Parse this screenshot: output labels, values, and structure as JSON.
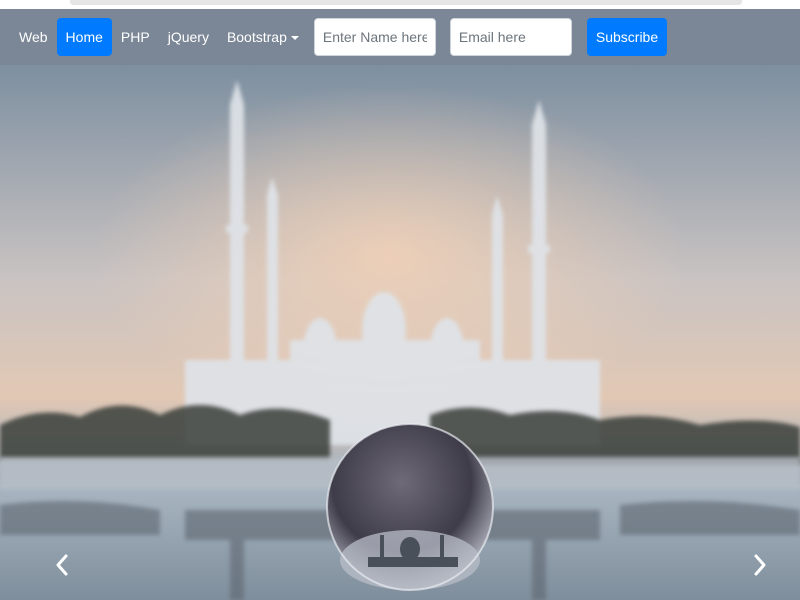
{
  "navbar": {
    "links": [
      {
        "label": "Web",
        "active": false
      },
      {
        "label": "Home",
        "active": true
      },
      {
        "label": "PHP",
        "active": false
      },
      {
        "label": "jQuery",
        "active": false
      },
      {
        "label": "Bootstrap",
        "active": false,
        "dropdown": true
      }
    ],
    "name_input": {
      "placeholder": "Enter Name here",
      "value": ""
    },
    "email_input": {
      "placeholder": "Email here",
      "value": ""
    },
    "subscribe_label": "Subscribe"
  },
  "carousel": {
    "slide_image": "mosque-reflection-glass-ball",
    "prev_icon": "chevron-left-icon",
    "next_icon": "chevron-right-icon"
  },
  "colors": {
    "navbar_bg": "#7b8796",
    "primary": "#007bff",
    "white": "#ffffff"
  }
}
